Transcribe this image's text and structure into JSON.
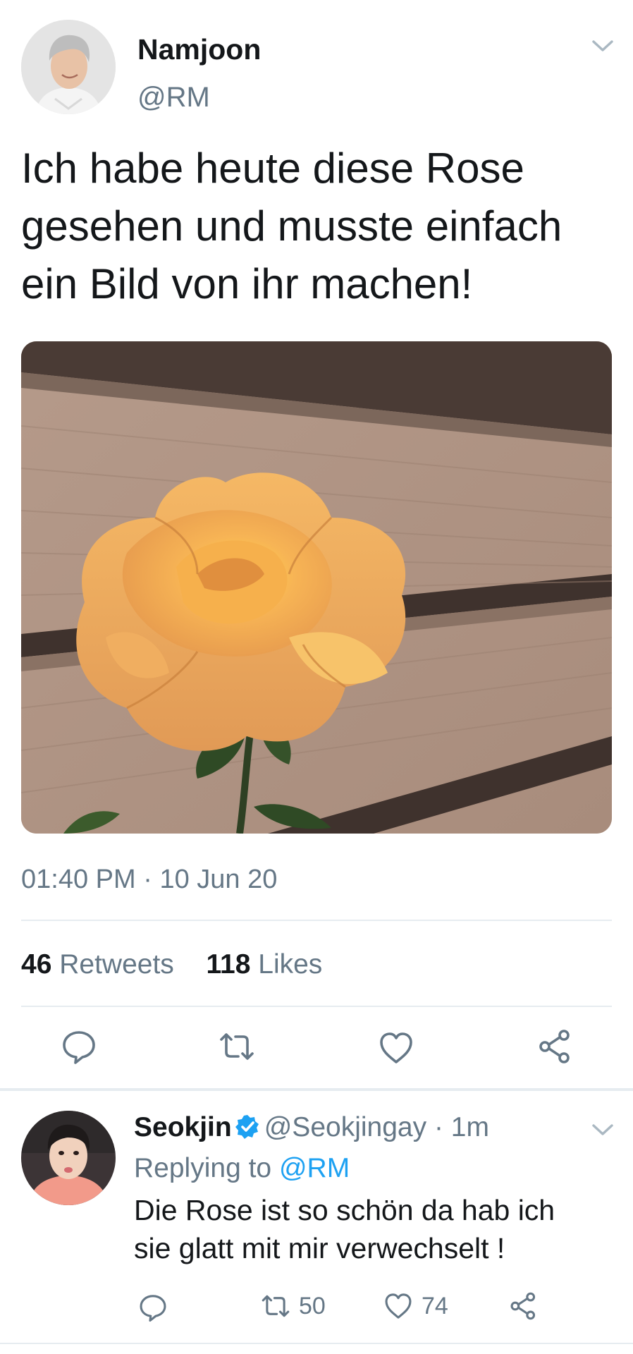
{
  "tweet": {
    "author": {
      "display_name": "Namjoon",
      "handle": "@RM"
    },
    "text_lines": [
      "Ich habe heute diese Rose",
      "gesehen und musste einfach",
      "ein Bild von ihr machen!"
    ],
    "time": "01:40 PM",
    "separator": "·",
    "date": "10 Jun 20",
    "retweets": {
      "count": "46",
      "label": "Retweets"
    },
    "likes": {
      "count": "118",
      "label": "Likes"
    }
  },
  "reply": {
    "author": {
      "display_name": "Seokjin",
      "handle": "@Seokjingay",
      "verified": true
    },
    "separator": "·",
    "age": "1m",
    "replying_prefix": "Replying to",
    "replying_mention": "@RM",
    "text_lines": [
      "Die Rose ist so schön da hab ich",
      "sie glatt mit mir verwechselt !"
    ],
    "retweet_count": "50",
    "like_count": "74"
  },
  "icons": {
    "chevron": "chevron-down-icon",
    "reply": "reply-icon",
    "retweet": "retweet-icon",
    "like": "heart-icon",
    "share": "share-icon",
    "verified": "verified-badge-icon"
  },
  "colors": {
    "text": "#14171a",
    "secondary": "#657786",
    "accent": "#1da1f2",
    "divider": "#e6ecf0"
  }
}
